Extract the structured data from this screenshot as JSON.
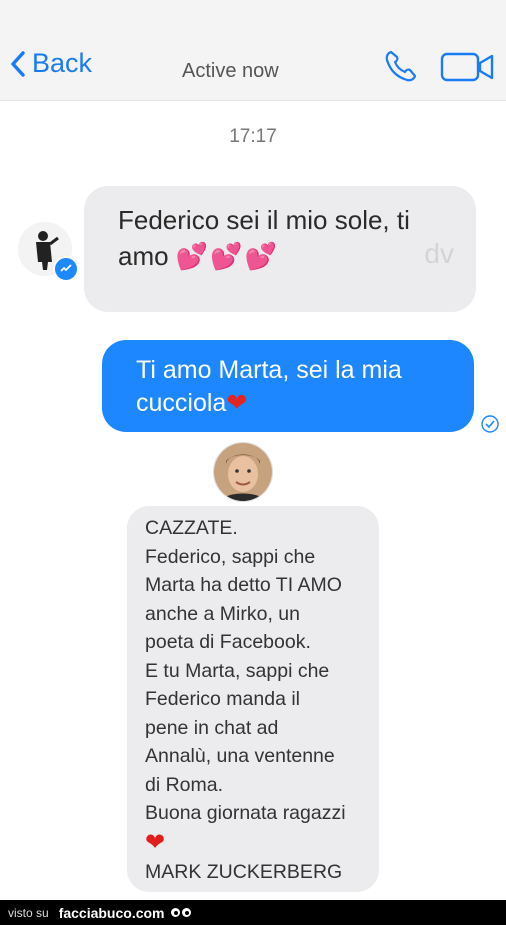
{
  "header": {
    "back_label": "Back",
    "status": "Active now",
    "accent_color": "#1a7cf5",
    "icons": [
      "chevron-left-icon",
      "phone-icon",
      "video-camera-icon"
    ]
  },
  "timestamp": "17:17",
  "messages": [
    {
      "direction": "incoming",
      "text": "Federico sei il mio sole, ti",
      "text2": "amo",
      "emoji": "💕💕💕",
      "watermark": "dv"
    },
    {
      "direction": "outgoing",
      "text": "Ti amo Marta, sei la mia",
      "text2": "cucciola",
      "emoji": "❤"
    },
    {
      "direction": "incoming",
      "lines": [
        "CAZZATE.",
        "Federico, sappi che",
        "Marta ha detto TI AMO",
        "anche a Mirko, un",
        "poeta di Facebook.",
        "E tu Marta, sappi che",
        "Federico manda il",
        "pene in chat ad",
        "Annalù, una ventenne",
        "di Roma.",
        "Buona giornata ragazzi"
      ],
      "heart": "❤",
      "signature": "MARK ZUCKERBERG"
    }
  ],
  "footer": {
    "prefix": "visto su",
    "brand": "facciabuco.com"
  }
}
